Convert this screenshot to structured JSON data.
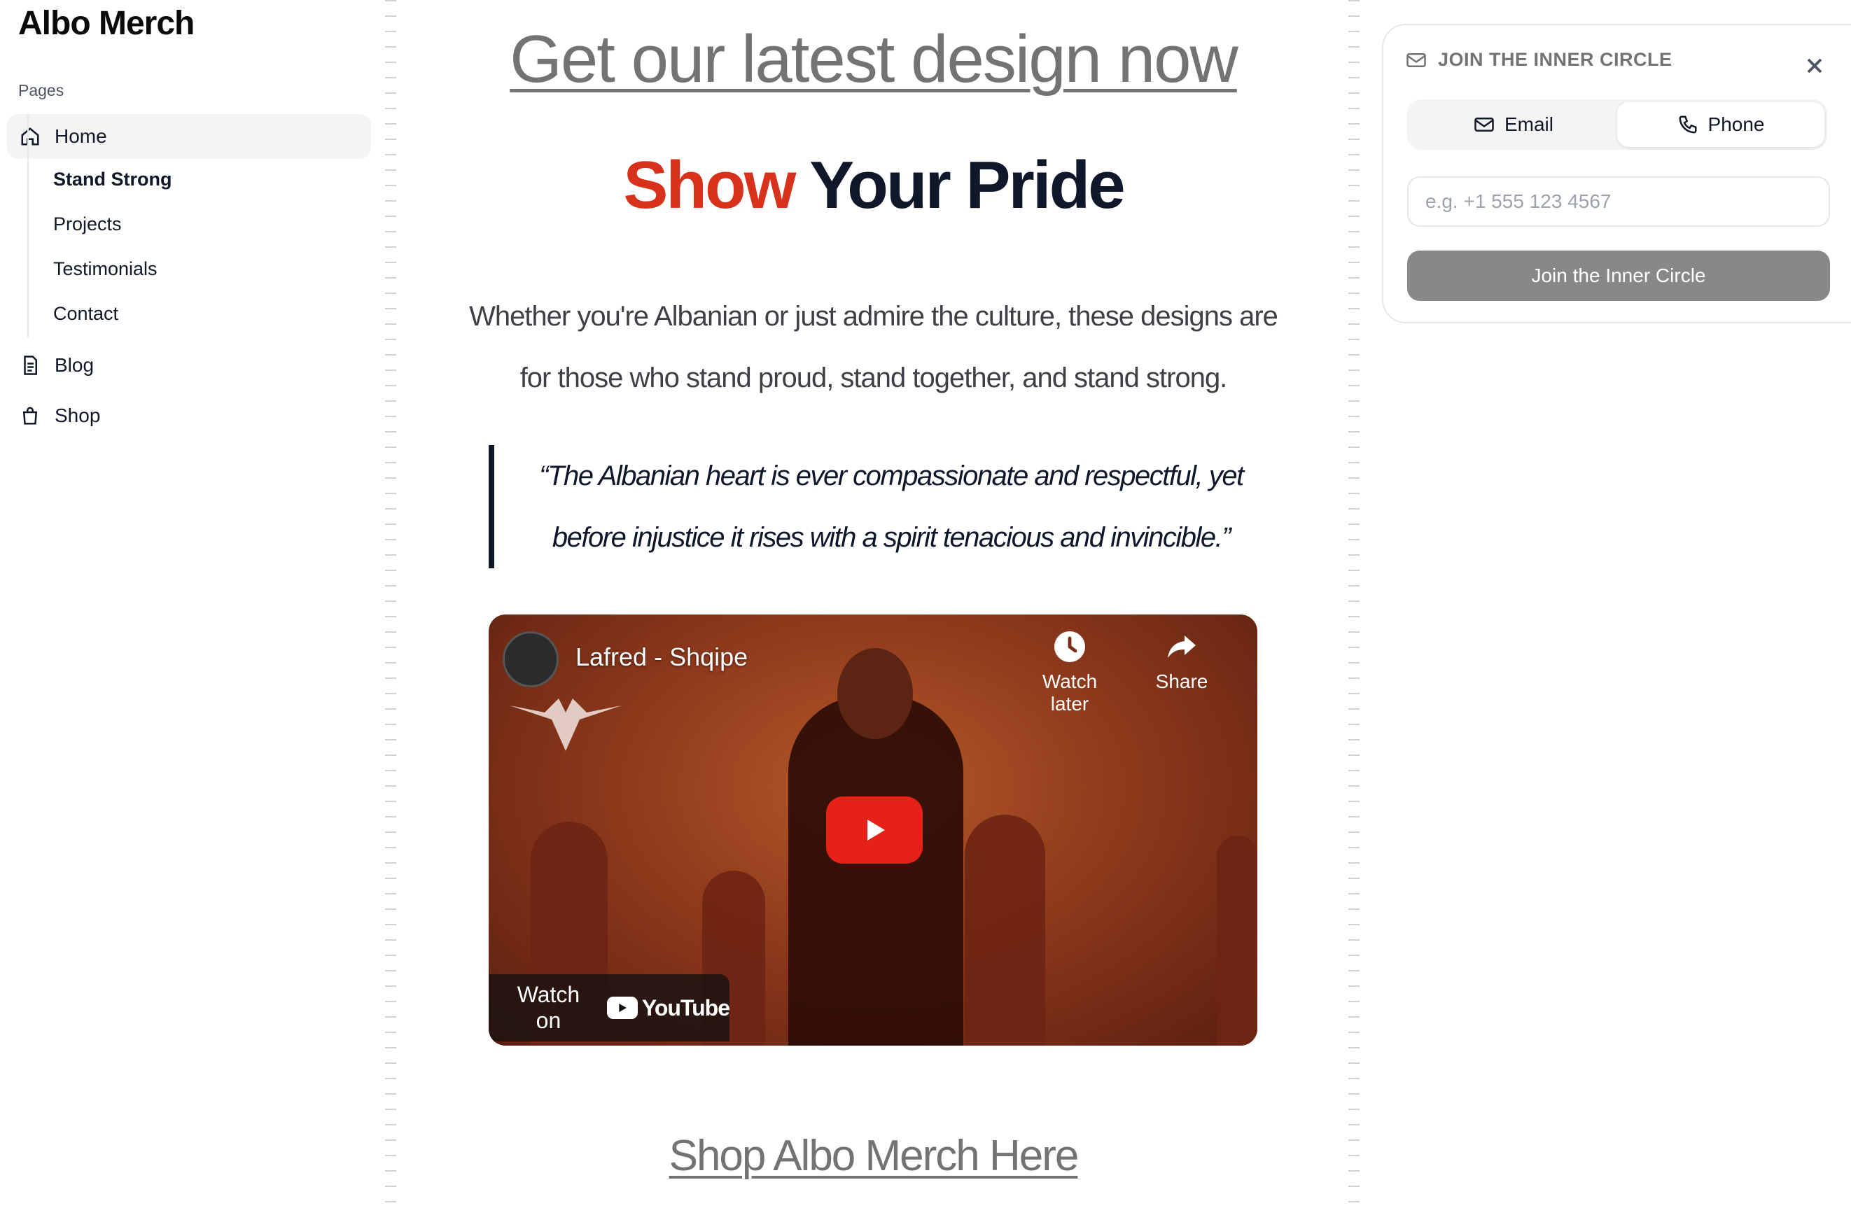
{
  "brand": "Albo Merch",
  "sidebar": {
    "section_label": "Pages",
    "items": [
      {
        "label": "Home"
      },
      {
        "label": "Blog"
      },
      {
        "label": "Shop"
      }
    ],
    "subitems": [
      {
        "label": "Stand Strong"
      },
      {
        "label": "Projects"
      },
      {
        "label": "Testimonials"
      },
      {
        "label": "Contact"
      }
    ]
  },
  "main": {
    "top_link": "Get our latest design now",
    "hero_accent": "Show",
    "hero_rest": "Your Pride",
    "lede": "Whether you're Albanian or just admire the culture, these designs are for those who stand proud, stand together, and stand strong.",
    "quote": "“The Albanian heart is ever compassionate and respectful, yet before injustice it rises with a spirit tenacious and invincible.”",
    "bottom_link": "Shop Albo Merch Here"
  },
  "video": {
    "title": "Lafred - Shqipe",
    "watch_later": "Watch later",
    "share": "Share",
    "watch_on": "Watch on",
    "youtube": "YouTube"
  },
  "panel": {
    "title": "JOIN THE INNER CIRCLE",
    "tab_email": "Email",
    "tab_phone": "Phone",
    "phone_placeholder": "e.g. +1 555 123 4567",
    "phone_value": "",
    "submit": "Join the Inner Circle"
  },
  "colors": {
    "accent_red": "#d8321c",
    "navy": "#0f172a",
    "link_gray": "#737373",
    "button_gray": "#888888",
    "youtube_red": "#e62117"
  }
}
